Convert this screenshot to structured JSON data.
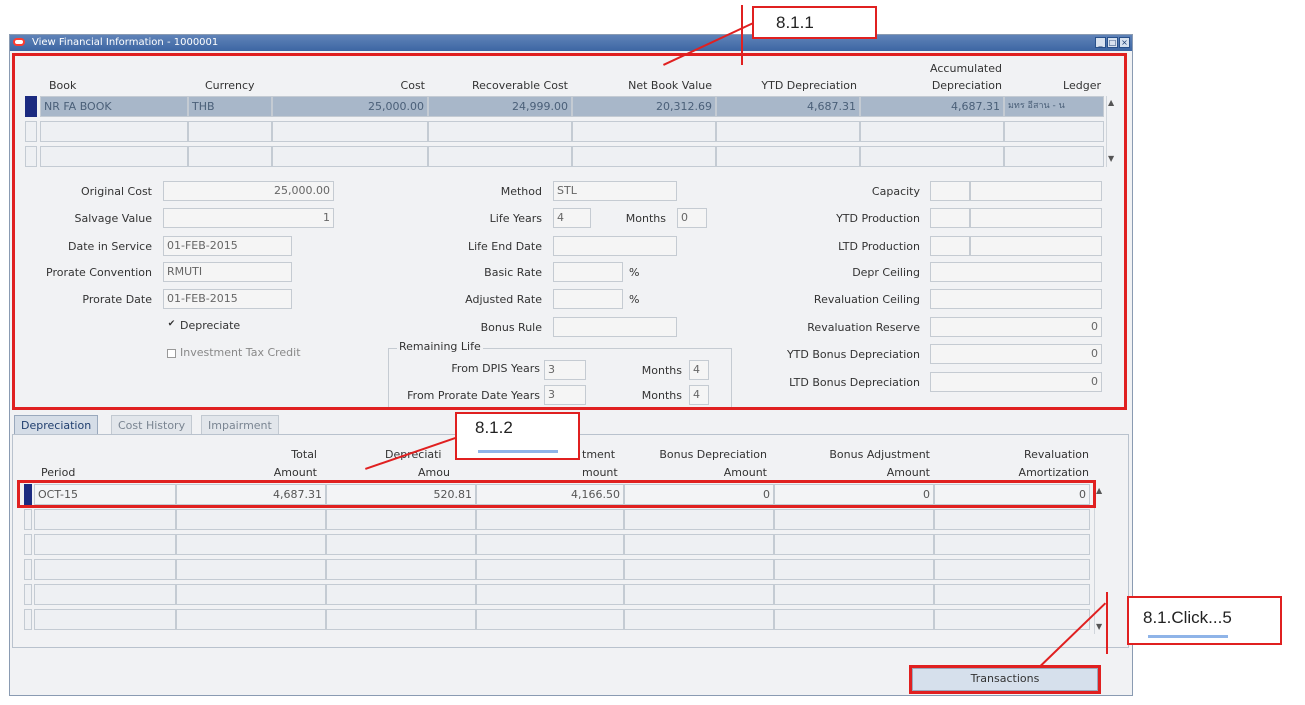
{
  "window": {
    "title": "View Financial Information - 1000001"
  },
  "callouts": {
    "c1": "8.1.1",
    "c2": "8.1.2",
    "c3": "8.1.Click...5"
  },
  "top_table": {
    "headers": {
      "book": "Book",
      "currency": "Currency",
      "cost": "Cost",
      "recoverable_cost": "Recoverable Cost",
      "net_book_value": "Net Book Value",
      "ytd_depreciation": "YTD Depreciation",
      "accumulated_line1": "Accumulated",
      "accumulated_line2": "Depreciation",
      "ledger": "Ledger"
    },
    "row": {
      "book": "NR FA BOOK",
      "currency": "THB",
      "cost": "25,000.00",
      "recoverable_cost": "24,999.00",
      "net_book_value": "20,312.69",
      "ytd_depreciation": "4,687.31",
      "accumulated": "4,687.31",
      "ledger": "มทร อีสาน - น"
    }
  },
  "details": {
    "original_cost_label": "Original Cost",
    "original_cost": "25,000.00",
    "salvage_value_label": "Salvage Value",
    "salvage_value": "1",
    "date_in_service_label": "Date in Service",
    "date_in_service": "01-FEB-2015",
    "prorate_convention_label": "Prorate Convention",
    "prorate_convention": "RMUTI",
    "prorate_date_label": "Prorate Date",
    "prorate_date": "01-FEB-2015",
    "depreciate_label": "Depreciate",
    "itc_label": "Investment Tax Credit",
    "method_label": "Method",
    "method": "STL",
    "life_years_label": "Life Years",
    "life_years": "4",
    "months_label": "Months",
    "months": "0",
    "life_end_date_label": "Life End Date",
    "basic_rate_label": "Basic Rate",
    "percent": "%",
    "adjusted_rate_label": "Adjusted Rate",
    "bonus_rule_label": "Bonus Rule",
    "remaining_life_label": "Remaining Life",
    "from_dpis_label": "From DPIS Years",
    "from_dpis_years": "3",
    "from_dpis_months": "4",
    "from_prorate_label": "From Prorate Date Years",
    "from_prorate_years": "3",
    "from_prorate_months": "4",
    "capacity_label": "Capacity",
    "ytd_production_label": "YTD Production",
    "ltd_production_label": "LTD Production",
    "depr_ceiling_label": "Depr Ceiling",
    "revaluation_ceiling_label": "Revaluation Ceiling",
    "revaluation_reserve_label": "Revaluation Reserve",
    "revaluation_reserve": "0",
    "ytd_bonus_label": "YTD Bonus Depreciation",
    "ytd_bonus": "0",
    "ltd_bonus_label": "LTD Bonus Depreciation",
    "ltd_bonus": "0"
  },
  "tabs": [
    "Depreciation",
    "Cost History",
    "Impairment"
  ],
  "dep_table": {
    "headers": {
      "period": "Period",
      "total_1": "Total",
      "total_2": "Amount",
      "dep_1": "Depreciati",
      "dep_2": "Amou",
      "adj_1": "tment",
      "adj_2": "mount",
      "bonus_dep_1": "Bonus Depreciation",
      "bonus_dep_2": "Amount",
      "bonus_adj_1": "Bonus Adjustment",
      "bonus_adj_2": "Amount",
      "reval_1": "Revaluation",
      "reval_2": "Amortization"
    },
    "row": {
      "period": "OCT-15",
      "total": "4,687.31",
      "depreciation": "520.81",
      "adjustment": "4,166.50",
      "bonus_dep": "0",
      "bonus_adj": "0",
      "reval": "0"
    }
  },
  "buttons": {
    "transactions": "Transactions"
  }
}
